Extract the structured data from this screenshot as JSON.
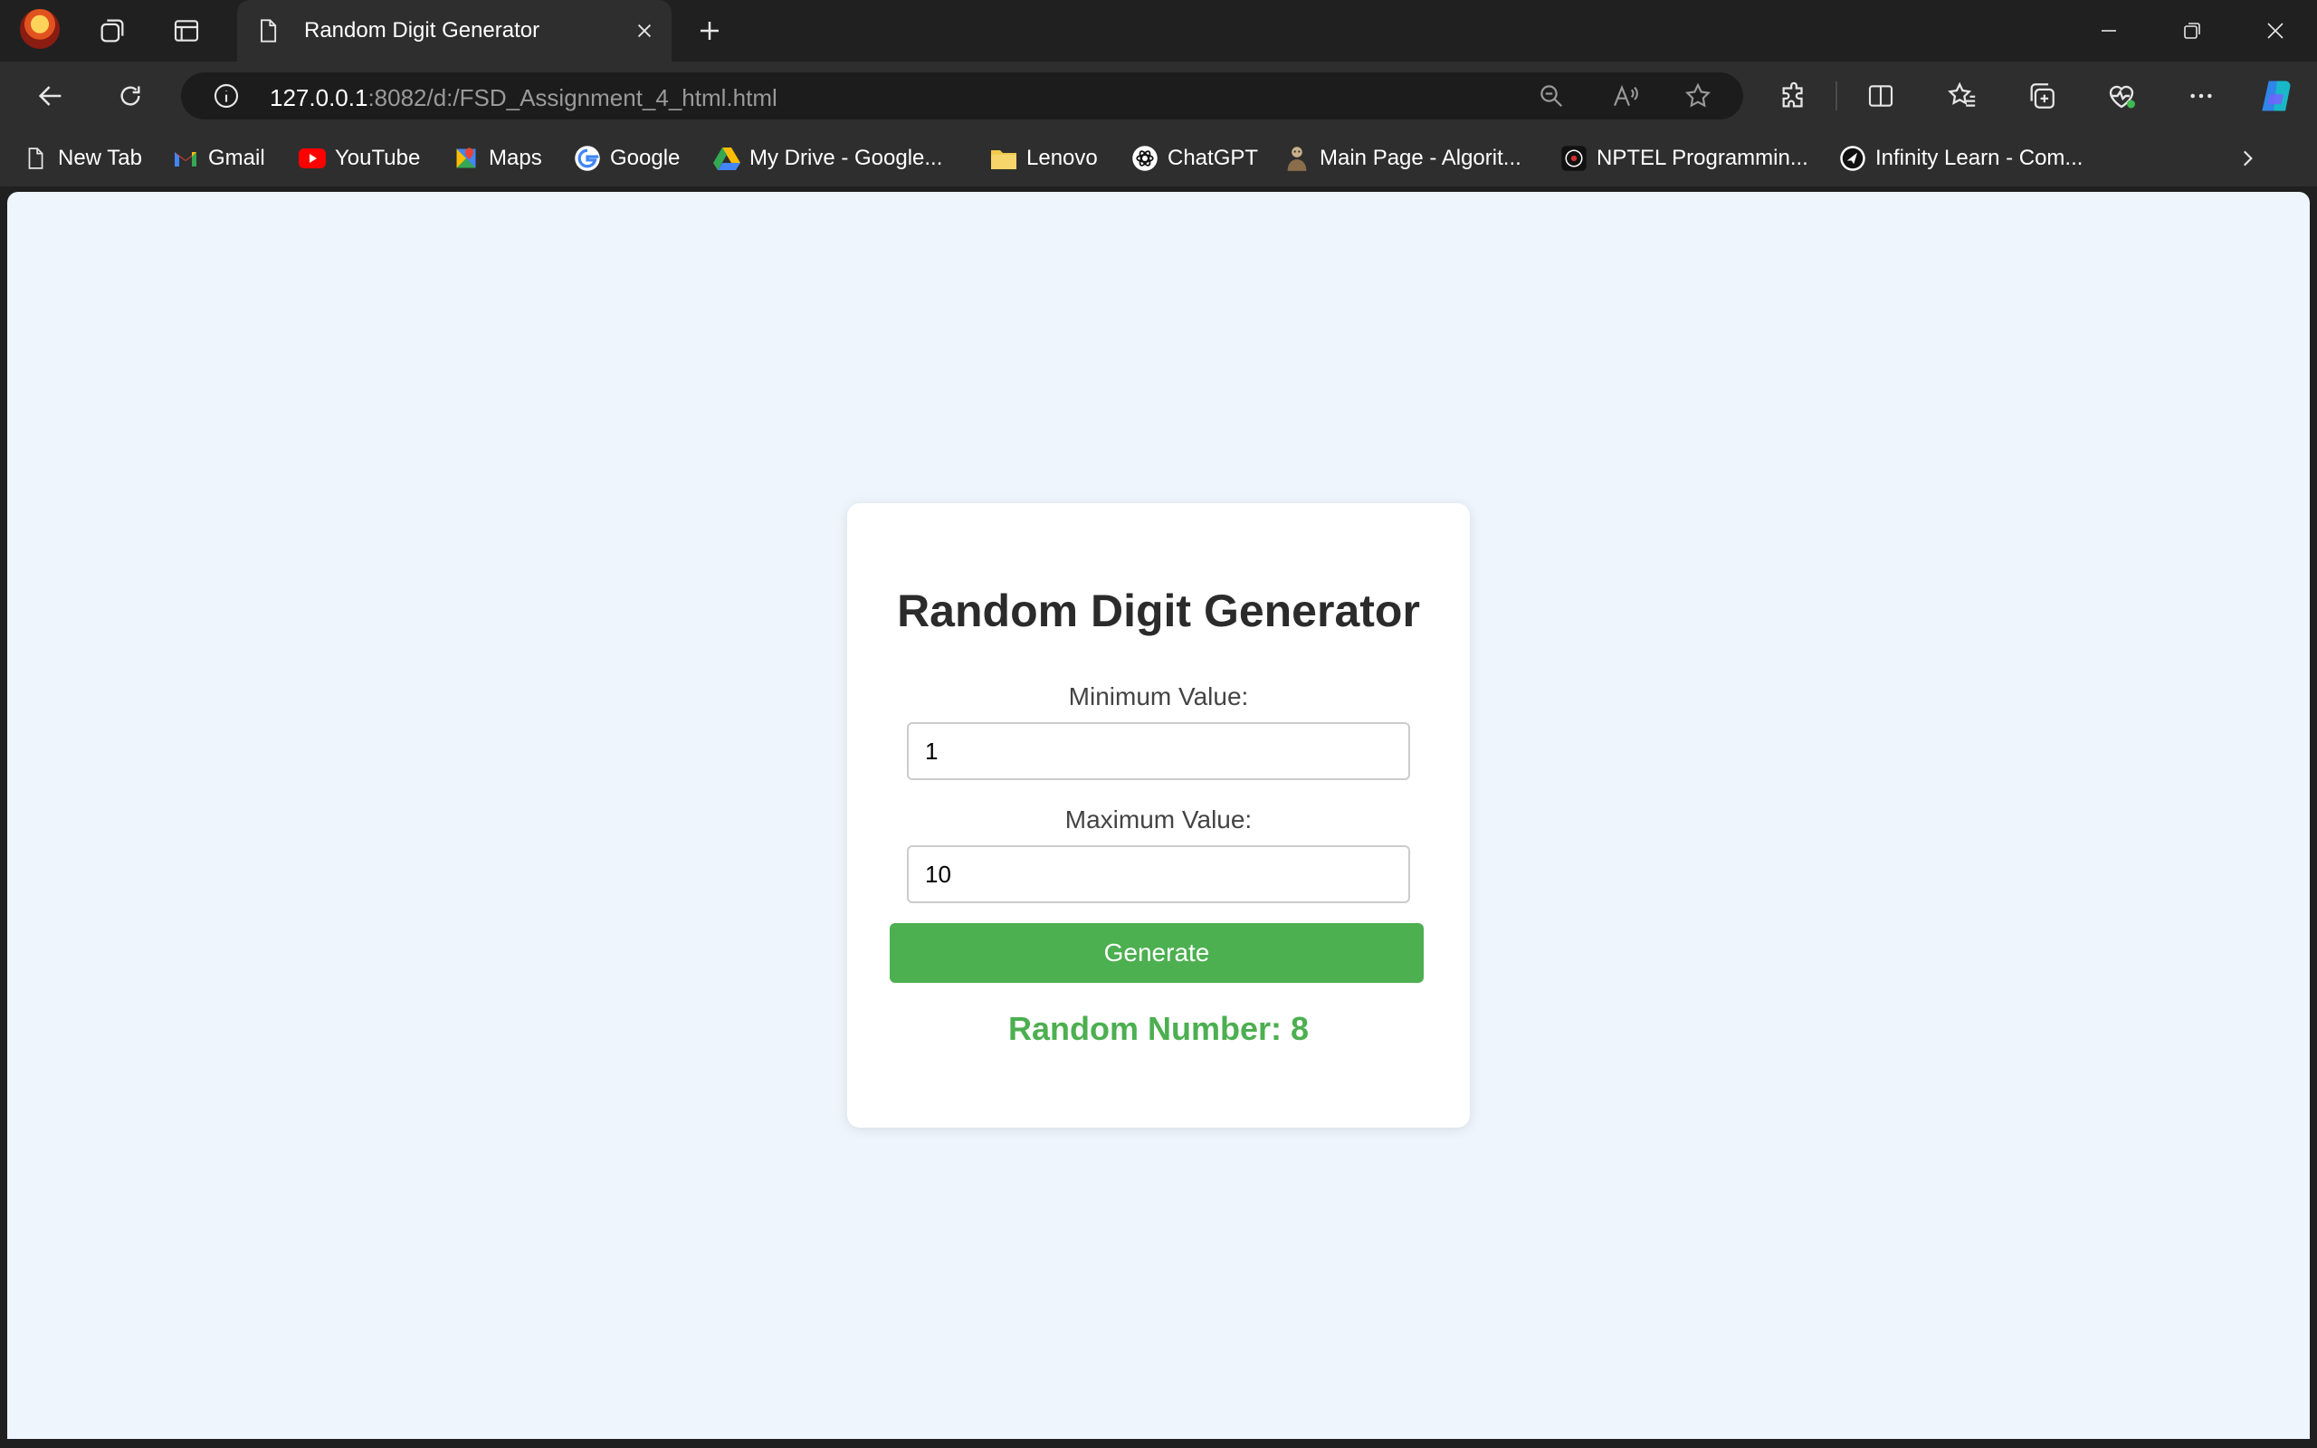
{
  "browser": {
    "tab": {
      "title": "Random Digit Generator"
    },
    "address": {
      "host": "127.0.0.1",
      "rest": ":8082/d:/FSD_Assignment_4_html.html"
    },
    "icons": {
      "profile": "profile-avatar",
      "workspaces": "workspaces-icon",
      "tab_actions": "tab-actions-icon",
      "page": "page-icon",
      "close": "close-icon",
      "new_tab": "plus-icon",
      "minimize": "minimize-icon",
      "restore": "restore-icon",
      "window_close": "close-icon",
      "back": "back-arrow-icon",
      "refresh": "refresh-icon",
      "site_info": "info-icon",
      "zoom": "zoom-out-icon",
      "read_aloud": "read-aloud-icon",
      "favorite": "star-icon",
      "extensions": "puzzle-icon",
      "split_screen": "split-screen-icon",
      "favorites": "favorites-icon",
      "collections": "collections-icon",
      "browser_essentials": "heart-pulse-icon",
      "more": "more-icon",
      "copilot": "copilot-icon",
      "bookmarks_overflow": "chevron-right-icon"
    }
  },
  "bookmarks": [
    {
      "label": "New Tab",
      "icon": "page-icon"
    },
    {
      "label": "Gmail",
      "icon": "gmail-icon"
    },
    {
      "label": "YouTube",
      "icon": "youtube-icon"
    },
    {
      "label": "Maps",
      "icon": "maps-icon"
    },
    {
      "label": "Google",
      "icon": "google-icon"
    },
    {
      "label": "My Drive - Google...",
      "icon": "drive-icon"
    },
    {
      "label": "Lenovo",
      "icon": "folder-icon"
    },
    {
      "label": "ChatGPT",
      "icon": "chatgpt-icon"
    },
    {
      "label": "Main Page - Algorit...",
      "icon": "algorithmica-icon"
    },
    {
      "label": "NPTEL Programmin...",
      "icon": "nptel-icon"
    },
    {
      "label": "Infinity Learn - Com...",
      "icon": "infinity-learn-icon"
    }
  ],
  "app": {
    "title": "Random Digit Generator",
    "min_label": "Minimum Value:",
    "min_value": "1",
    "max_label": "Maximum Value:",
    "max_value": "10",
    "button_label": "Generate",
    "result_text": "Random Number: 8"
  },
  "colors": {
    "page_background": "#eef5fd",
    "accent_green": "#4caf50",
    "chrome_dark": "#202020",
    "toolbar": "#2e2e2e"
  }
}
